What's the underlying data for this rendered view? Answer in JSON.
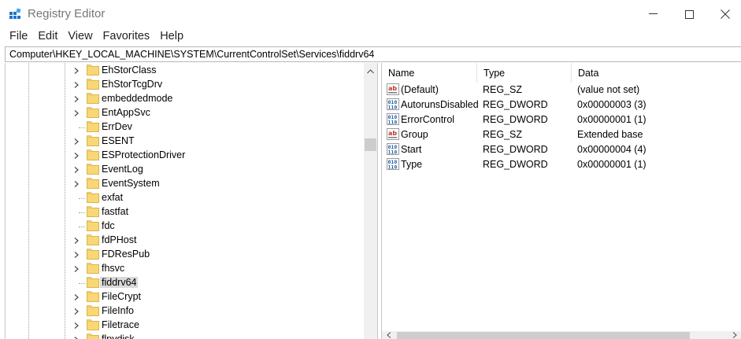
{
  "window": {
    "title": "Registry Editor",
    "icon": "registry-editor-icon",
    "controls": [
      "minimize",
      "maximize",
      "close"
    ]
  },
  "menu": [
    "File",
    "Edit",
    "View",
    "Favorites",
    "Help"
  ],
  "address": "Computer\\HKEY_LOCAL_MACHINE\\SYSTEM\\CurrentControlSet\\Services\\fiddrv64",
  "tree": {
    "items": [
      {
        "label": "EhStorClass",
        "expandable": true
      },
      {
        "label": "EhStorTcgDrv",
        "expandable": true
      },
      {
        "label": "embeddedmode",
        "expandable": true
      },
      {
        "label": "EntAppSvc",
        "expandable": true
      },
      {
        "label": "ErrDev",
        "expandable": false
      },
      {
        "label": "ESENT",
        "expandable": true
      },
      {
        "label": "ESProtectionDriver",
        "expandable": true
      },
      {
        "label": "EventLog",
        "expandable": true
      },
      {
        "label": "EventSystem",
        "expandable": true
      },
      {
        "label": "exfat",
        "expandable": false
      },
      {
        "label": "fastfat",
        "expandable": false
      },
      {
        "label": "fdc",
        "expandable": false
      },
      {
        "label": "fdPHost",
        "expandable": true
      },
      {
        "label": "FDResPub",
        "expandable": true
      },
      {
        "label": "fhsvc",
        "expandable": true
      },
      {
        "label": "fiddrv64",
        "expandable": false,
        "selected": true
      },
      {
        "label": "FileCrypt",
        "expandable": true
      },
      {
        "label": "FileInfo",
        "expandable": true
      },
      {
        "label": "Filetrace",
        "expandable": true
      },
      {
        "label": "flpydisk",
        "expandable": true
      }
    ]
  },
  "list": {
    "columns": [
      "Name",
      "Type",
      "Data"
    ],
    "rows": [
      {
        "name": "(Default)",
        "type": "REG_SZ",
        "data": "(value not set)",
        "icon": "string-value-icon"
      },
      {
        "name": "AutorunsDisabled",
        "type": "REG_DWORD",
        "data": "0x00000003 (3)",
        "icon": "binary-value-icon"
      },
      {
        "name": "ErrorControl",
        "type": "REG_DWORD",
        "data": "0x00000001 (1)",
        "icon": "binary-value-icon"
      },
      {
        "name": "Group",
        "type": "REG_SZ",
        "data": "Extended base",
        "icon": "string-value-icon"
      },
      {
        "name": "Start",
        "type": "REG_DWORD",
        "data": "0x00000004 (4)",
        "icon": "binary-value-icon"
      },
      {
        "name": "Type",
        "type": "REG_DWORD",
        "data": "0x00000001 (1)",
        "icon": "binary-value-icon"
      }
    ]
  },
  "colors": {
    "folder": "#f8d775",
    "folder_edge": "#dcb44a",
    "selection": "#d9d9d9",
    "string_icon": "#c0392b",
    "binary_icon": "#1f5fa8"
  }
}
